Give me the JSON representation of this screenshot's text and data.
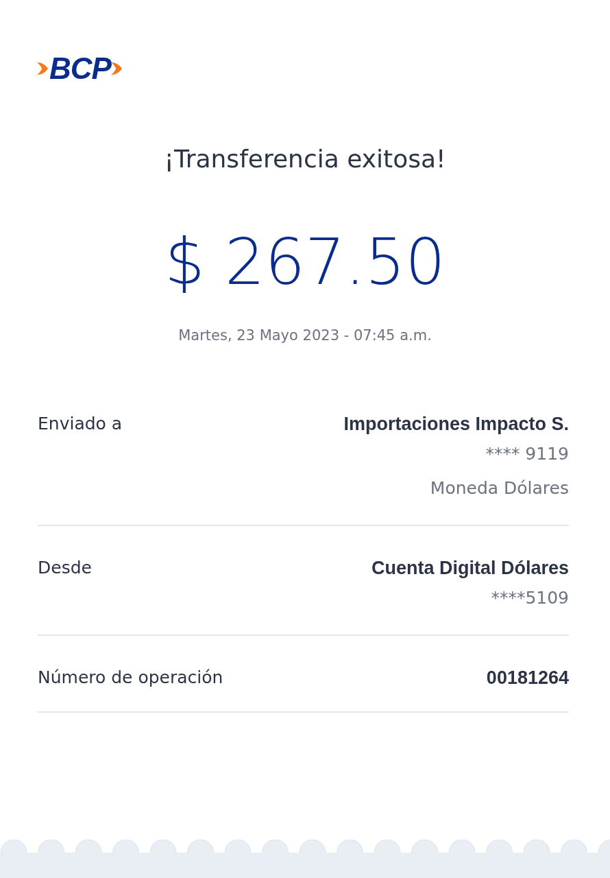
{
  "logo": {
    "text": "BCP"
  },
  "title": "¡Transferencia exitosa!",
  "amount": "$ 267.50",
  "date": "Martes, 23 Mayo 2023 - 07:45 a.m.",
  "details": [
    {
      "label": "Enviado a",
      "value": "Importaciones Impacto S.",
      "extra": [
        "**** 9119",
        "Moneda Dólares"
      ]
    },
    {
      "label": "Desde",
      "value": "Cuenta Digital Dólares",
      "extra": [
        "****5109"
      ]
    },
    {
      "label": "Número de operación",
      "value": "00181264"
    }
  ]
}
